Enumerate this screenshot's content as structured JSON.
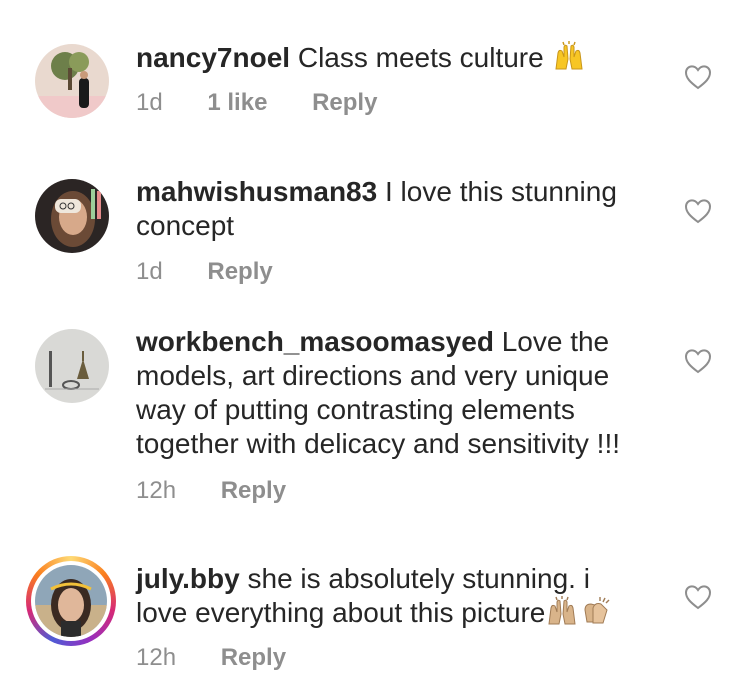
{
  "comments": [
    {
      "username": "nancy7noel",
      "text": "Class meets culture",
      "time": "1d",
      "likes": "1 like",
      "reply": "Reply",
      "emoji": "raised-hands-emoji"
    },
    {
      "username": "mahwishusman83",
      "text_line1": "I love this stunning",
      "text_line2": "concept",
      "time": "1d",
      "reply": "Reply"
    },
    {
      "username": "workbench_masoomasyed",
      "text_line1": "Love the",
      "text_line2": "models, art directions  and very unique",
      "text_line3": "way of putting contrasting elements",
      "text_line4": "together with delicacy and sensitivity !!!",
      "time": "12h",
      "reply": "Reply"
    },
    {
      "username": "july.bby",
      "text_line1": "she is absolutely stunning. i",
      "text_line2": "love everything about this picture",
      "time": "12h",
      "reply": "Reply",
      "emoji": [
        "raised-hands-emoji",
        "clapping-hands-emoji"
      ]
    }
  ],
  "colors": {
    "text": "#262626",
    "meta": "#8e8e8e",
    "heart": "#8e8e8e"
  },
  "icons": {
    "like": "heart-outline-icon"
  }
}
